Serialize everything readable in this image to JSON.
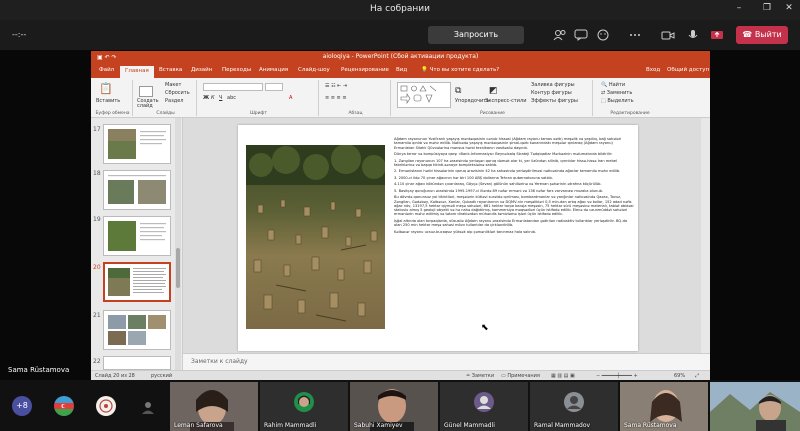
{
  "window": {
    "title": "На собрании",
    "minimize": "–",
    "maximize": "❐",
    "close": "✕"
  },
  "callbar": {
    "timer": "--:--",
    "request_control_label": "Запросить управление",
    "leave_label": "Выйти",
    "accent_leave": "#c4314b"
  },
  "ppt": {
    "title": "aioloqiya - PowerPoint (Сбой активации продукта)",
    "tabs": [
      "Файл",
      "Главная",
      "Вставка",
      "Дизайн",
      "Переходы",
      "Анимация",
      "Слайд-шоу",
      "Рецензирование",
      "Вид"
    ],
    "active_tab": "Главная",
    "tell_me": "Что вы хотите сделать?",
    "sign_in": "Вход",
    "share": "Общий доступ",
    "ribbon": {
      "paste": "Вставить",
      "clipboard": "Буфер обмена",
      "new_slide": "Создать слайд",
      "layout": "Макет",
      "reset": "Сбросить",
      "section": "Раздел",
      "slides": "Слайды",
      "font": "Шрифт",
      "paragraph": "Абзац",
      "arrange": "Упорядочить",
      "quick_styles": "Экспресс-стили",
      "shape_fill": "Заливка фигуры",
      "shape_outline": "Контур фигуры",
      "shape_effects": "Эффекты фигуры",
      "drawing": "Рисование",
      "find": "Найти",
      "replace": "Заменить",
      "select": "Выделить",
      "editing": "Редактирование"
    },
    "thumbnails": [
      {
        "num": "17"
      },
      {
        "num": "18"
      },
      {
        "num": "19"
      },
      {
        "num": "20"
      },
      {
        "num": "21"
      },
      {
        "num": "22"
      }
    ],
    "slide_text": [
      "Ağdam rayonunun Yusifcanlı yaşayış məntəqəsinin cənub hissəsi (Ağdam rayonu tamas xəttı) meşəlik və yaşıllıq, bağ sahələri tamamilə qırılıb və məhv edilib. Nəticədə yaşayış məntəqəsinin şimal-qərb kənarındakı meşələr qırılaraq (Ağdam rayonu) Ermənistan Silahlı Qüvvələrinə mənsus hərbi texnikanın vasitəsilə daşınıb.",
      "Dünya terror və kompüsiyaya qarşı «Bank-İnformasiya» Beynəlxalq Strateji Tədqiqatlar Mərkəzinin məlumatında bildirilir:",
      "1. Zəngilan rayonunun 107 ha ərazisində yerləşən qoruq dəmək olar ki, yer üzündən silinib, qırıntılar hissə-hissə İran mebel fabriklərinə və başqa tikinti-sənaye kompleksləinə satılıb.",
      "2. Ermənistanın hərbi hissələrinin qoruq ərazisinin 42 ha sahəsində yerləşdirilməsi nəticəsində ağaclar tamamilə məhv edilib.",
      "3. 2000-ci ildə 70 çinar ağacının hər biri 100 ABŞ dollarına Tehran qubernatoruna satılıb.",
      "4.110 çinar ağacı kökündən çıxarılaraq, Göyçə (Sevan) gölünün sahillərinə və Yerevan şəhərinin ətrafına köçürülüb.",
      "5. Basitçay qoruğunun ərazisində 1995-1997-ci illərdə 89 nəfər erməni və 136 nəfər fars varvarcası muzalıa olunub.",
      "Bu dövrdə qanunsuz yol tikintiləri, meşələrin kütləvi surətdə qırılması, bombardmanlar və yanğınlar nəticəsində Qazax, Tovuz, Zəngilan, Gədəbəy, Kəlbəcər, Xanlar, Qubadlı rayonlarının və DQMV-nin meşəlikləri 0,5 mln-dan artıq ağac və kollar, 152 adad nəfis ağac növ, 13197,5 hektar qiyməti meşə sahələri, 661 hektar torpa barəja meşəsin, 75 hektar sürü meşəsinə materialı, tabiət abidəsi statuslu almış 5 geoloji obyekt və hə nahə dağıdılmış, kommersiya məqsədləri üçün istifadə edilib. Elecə də uzunmüddət sahələri ermənlərin məhv edilmiş və tətom dirakiərdən mühəndis təmizləmə işləri üçün istifadə edilib.",
      "İşğal altında olan torpaqlarda, xüsusilə Ağdam rayonu ərazisində Ermənistandan gətirilən radioaktiv tullantılar yerləşdirilir. BQ-da olan 250 min hektar meşə sahəsi mövv tullantılar da çirkləndirilib.",
      "Kəlbəcər rayonu ucsuz-bucaqsız yüksək alp çəmənlikləri tanınmaz hala salınıb."
    ],
    "notes_placeholder": "Заметки к слайду",
    "status": {
      "slide_counter": "Слайд 20 из 28",
      "language": "русский",
      "notes": "Заметки",
      "comments": "Примечания",
      "zoom": "69%"
    },
    "accent": "#c4421f"
  },
  "presenter": {
    "name": "Sama Rüstamova"
  },
  "gallery": {
    "more_count": "+8",
    "participants": [
      {
        "name": "Leman Safarova"
      },
      {
        "name": "Rahim Mammadli"
      },
      {
        "name": "Sabuhi Xamiyev"
      },
      {
        "name": "Günel Mammadli"
      },
      {
        "name": "Ramal Mammadov"
      },
      {
        "name": "Sama Rüstamova"
      }
    ]
  }
}
